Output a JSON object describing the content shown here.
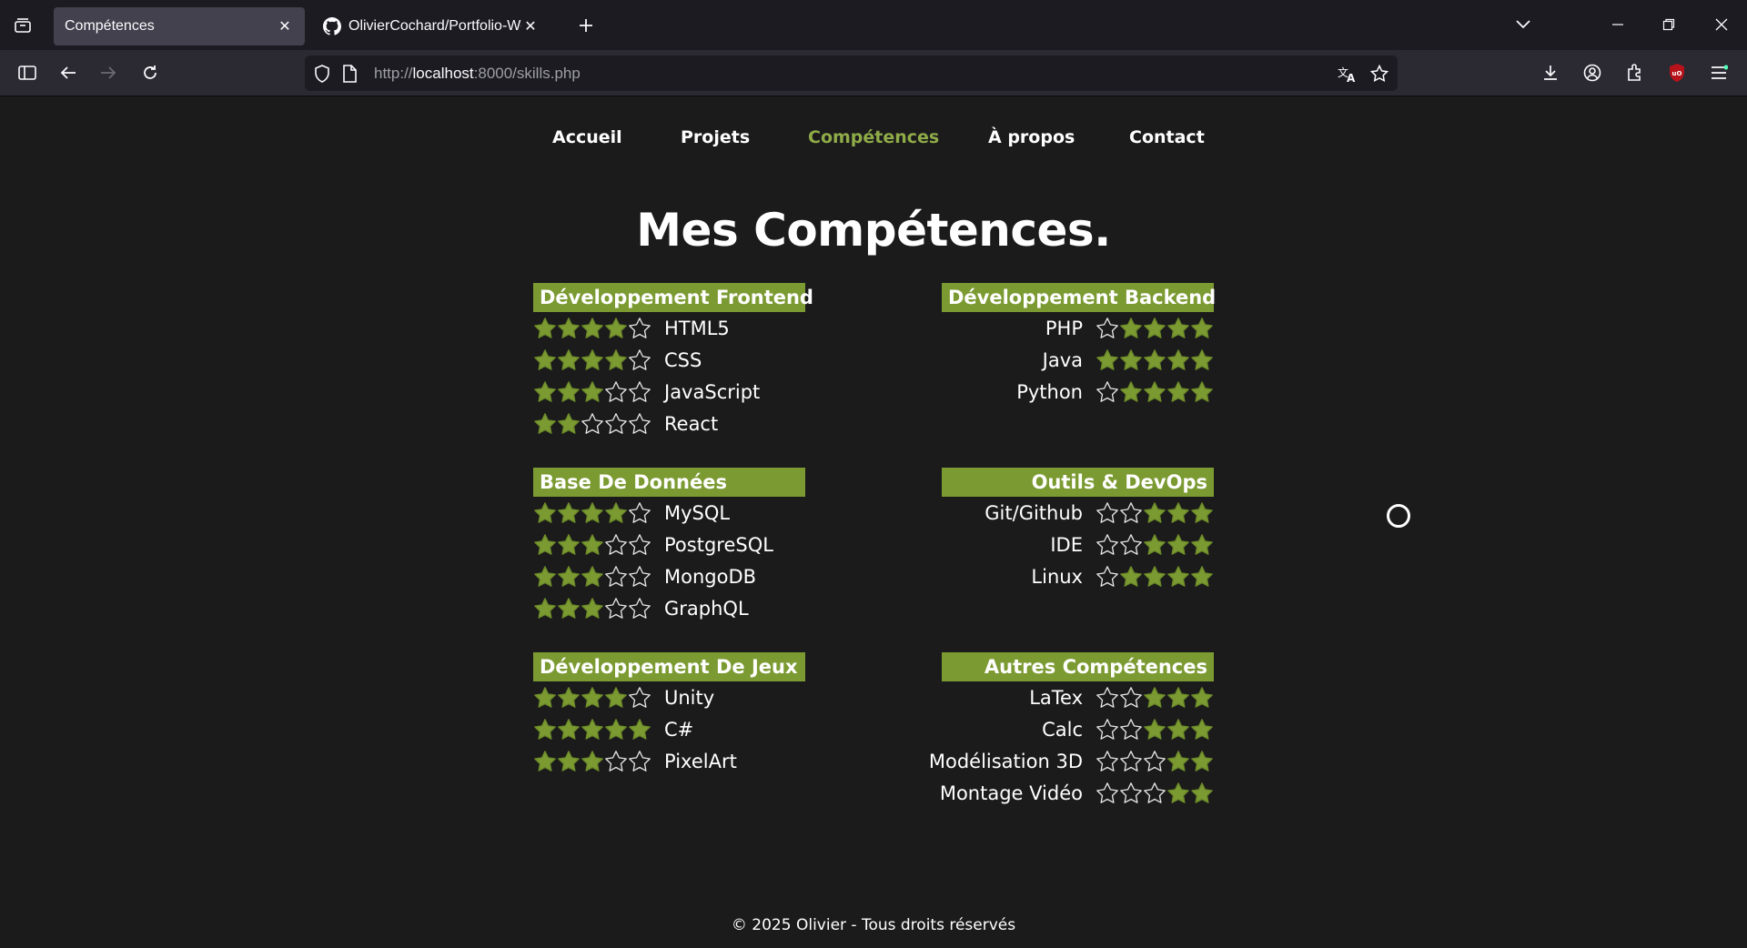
{
  "browser": {
    "tabs": [
      {
        "label": "Compétences",
        "active": true
      },
      {
        "label": "OlivierCochard/Portfolio-Websi",
        "active": false,
        "icon": "github-icon"
      }
    ],
    "url": {
      "prefix": "http://",
      "host": "localhost",
      "rest": ":8000/skills.php"
    }
  },
  "nav": {
    "items": [
      "Accueil",
      "Projets",
      "Compétences",
      "À propos",
      "Contact"
    ],
    "current": "Compétences"
  },
  "page_title": "Mes Compétences.",
  "colors": {
    "accent": "#7b9a32",
    "nav_active": "#8fab48",
    "background": "#1b1b1b"
  },
  "categories": [
    {
      "title": "Développement Frontend",
      "side": "left",
      "skills": [
        {
          "name": "HTML5",
          "stars": 4
        },
        {
          "name": "CSS",
          "stars": 4
        },
        {
          "name": "JavaScript",
          "stars": 3
        },
        {
          "name": "React",
          "stars": 2
        }
      ]
    },
    {
      "title": "Développement Backend",
      "side": "right",
      "skills": [
        {
          "name": "PHP",
          "stars": 4
        },
        {
          "name": "Java",
          "stars": 5
        },
        {
          "name": "Python",
          "stars": 4
        }
      ]
    },
    {
      "title": "Base De Données",
      "side": "left",
      "skills": [
        {
          "name": "MySQL",
          "stars": 4
        },
        {
          "name": "PostgreSQL",
          "stars": 3
        },
        {
          "name": "MongoDB",
          "stars": 3
        },
        {
          "name": "GraphQL",
          "stars": 3
        }
      ]
    },
    {
      "title": "Outils & DevOps",
      "side": "right",
      "skills": [
        {
          "name": "Git/Github",
          "stars": 3
        },
        {
          "name": "IDE",
          "stars": 3
        },
        {
          "name": "Linux",
          "stars": 4
        }
      ]
    },
    {
      "title": "Développement De Jeux",
      "side": "left",
      "skills": [
        {
          "name": "Unity",
          "stars": 4
        },
        {
          "name": "C#",
          "stars": 5
        },
        {
          "name": "PixelArt",
          "stars": 3
        }
      ]
    },
    {
      "title": "Autres Compétences",
      "side": "right",
      "skills": [
        {
          "name": "LaTex",
          "stars": 3
        },
        {
          "name": "Calc",
          "stars": 3
        },
        {
          "name": "Modélisation 3D",
          "stars": 2
        },
        {
          "name": "Montage Vidéo",
          "stars": 2
        }
      ]
    }
  ],
  "footer": "© 2025 Olivier - Tous droits réservés"
}
